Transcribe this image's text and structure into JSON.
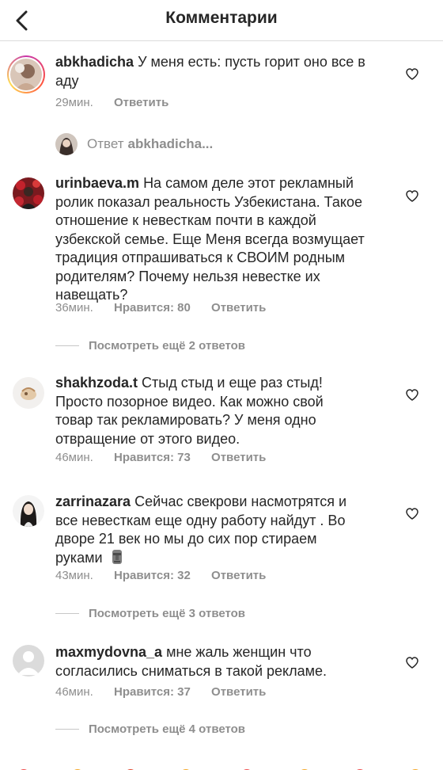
{
  "header": {
    "title": "Комментарии",
    "back_icon": "chevron-left-icon"
  },
  "comments": [
    {
      "username": "abkhadicha",
      "text": "У меня есть: пусть горит оно все в аду",
      "line1": "У меня есть: пусть горит оно все в",
      "line2": "аду",
      "time": "29мин.",
      "reply": "Ответить"
    },
    {
      "username": "urinbaeva.m",
      "lines": [
        "На самом деле этот рекламный",
        "ролик показал реальность Узбекистана. Такое",
        "отношение к невесткам почти в каждой",
        "узбекской семье. Еще Меня всегда возмущает",
        "традиция отпрашиваться к СВОИМ родным",
        "родителям? Почему нельзя невестке их",
        "навещать?"
      ],
      "time": "36мин.",
      "likes": "Нравится: 80",
      "reply": "Ответить",
      "view_replies": "Посмотреть ещё 2 ответов"
    },
    {
      "username": "shakhzoda.t",
      "lines": [
        "Стыд стыд и еще раз стыд!",
        "Просто позорное видео. Как можно свой",
        "товар так рекламировать? У меня одно",
        "отвращение от этого видео."
      ],
      "time": "46мин.",
      "likes": "Нравится: 73",
      "reply": "Ответить"
    },
    {
      "username": "zarrinazara",
      "lines": [
        "Сейчас свекрови насмотрятся и",
        "все невесткам еще одну работу найдут . Во",
        "дворе 21 век но мы до сих пор стираем",
        "руками"
      ],
      "emoji_name": "moai-icon",
      "time": "43мин.",
      "likes": "Нравится: 32",
      "reply": "Ответить",
      "view_replies": "Посмотреть ещё 3 ответов"
    },
    {
      "username": "maxmydovna_a",
      "lines": [
        "мне жаль женщин что",
        "согласились сниматься в такой рекламе."
      ],
      "time": "46мин.",
      "likes": "Нравится: 37",
      "reply": "Ответить",
      "view_replies": "Посмотреть ещё 4 ответов"
    }
  ],
  "reply_prompt": {
    "label": "Ответ",
    "username": "abkhadicha..."
  },
  "colors": {
    "text": "#262626",
    "muted": "#8e8e8e",
    "divider": "#dbdbdb"
  }
}
